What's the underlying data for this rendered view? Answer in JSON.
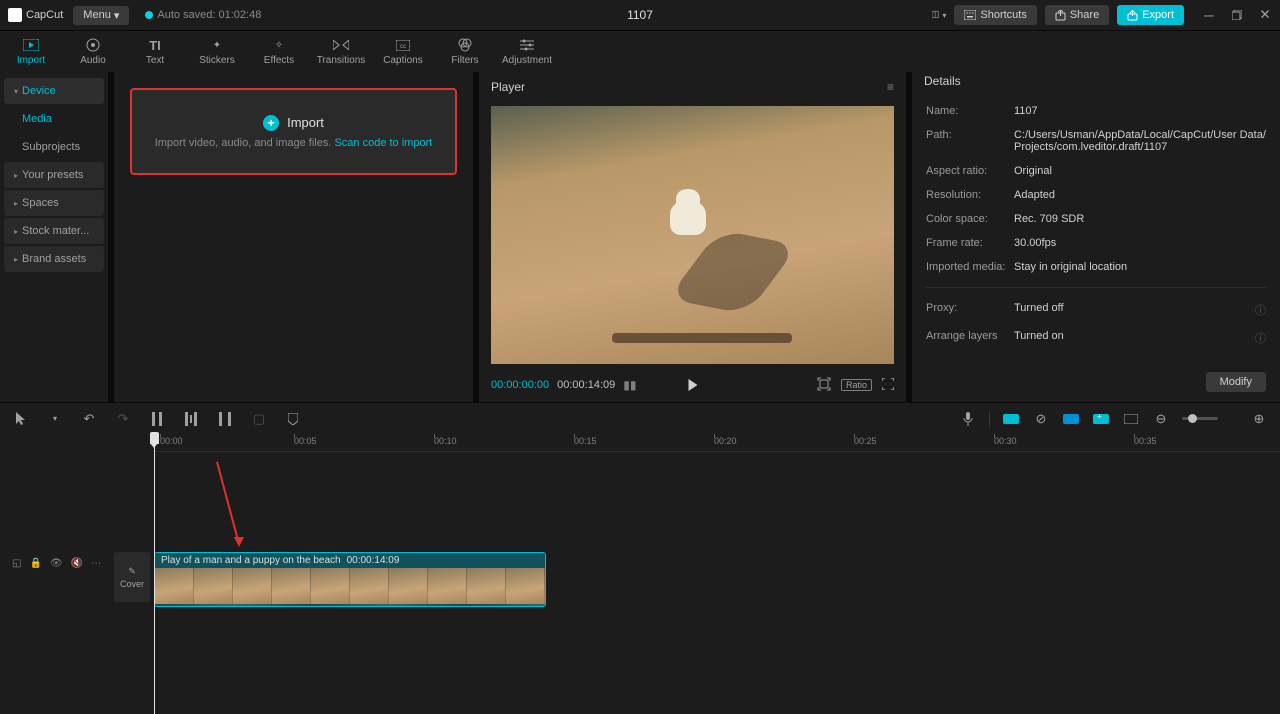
{
  "app": {
    "name": "CapCut",
    "menu_label": "Menu"
  },
  "autosave": {
    "label": "Auto saved: 01:02:48"
  },
  "project_title": "1107",
  "titlebar": {
    "shortcuts": "Shortcuts",
    "share": "Share",
    "export": "Export"
  },
  "ribbon": [
    {
      "id": "import",
      "label": "Import",
      "active": true
    },
    {
      "id": "audio",
      "label": "Audio"
    },
    {
      "id": "text",
      "label": "Text"
    },
    {
      "id": "stickers",
      "label": "Stickers"
    },
    {
      "id": "effects",
      "label": "Effects"
    },
    {
      "id": "transitions",
      "label": "Transitions"
    },
    {
      "id": "captions",
      "label": "Captions"
    },
    {
      "id": "filters",
      "label": "Filters"
    },
    {
      "id": "adjustment",
      "label": "Adjustment"
    }
  ],
  "sidebar": {
    "items": [
      {
        "label": "Device",
        "active": true,
        "expandable": true
      },
      {
        "label": "Media",
        "sub": true,
        "highlight": true
      },
      {
        "label": "Subprojects",
        "sub": true
      },
      {
        "label": "Your presets",
        "expandable": true
      },
      {
        "label": "Spaces",
        "expandable": true
      },
      {
        "label": "Stock mater...",
        "expandable": true
      },
      {
        "label": "Brand assets",
        "expandable": true
      }
    ]
  },
  "import_box": {
    "title": "Import",
    "subtitle": "Import video, audio, and image files. ",
    "link": "Scan code to import"
  },
  "player": {
    "header": "Player",
    "time_current": "00:00:00:00",
    "time_total": "00:00:14:09",
    "ratio": "Ratio"
  },
  "details": {
    "header": "Details",
    "name_label": "Name:",
    "name_value": "1107",
    "path_label": "Path:",
    "path_value": "C:/Users/Usman/AppData/Local/CapCut/User Data/Projects/com.lveditor.draft/1107",
    "aspect_label": "Aspect ratio:",
    "aspect_value": "Original",
    "res_label": "Resolution:",
    "res_value": "Adapted",
    "cs_label": "Color space:",
    "cs_value": "Rec. 709 SDR",
    "fr_label": "Frame rate:",
    "fr_value": "30.00fps",
    "im_label": "Imported media:",
    "im_value": "Stay in original location",
    "proxy_label": "Proxy:",
    "proxy_value": "Turned off",
    "layers_label": "Arrange layers",
    "layers_value": "Turned on",
    "modify": "Modify"
  },
  "timeline": {
    "ruler_ticks": [
      "00:00",
      "00:05",
      "00:10",
      "00:15",
      "00:20",
      "00:25",
      "00:30",
      "00:35"
    ],
    "cover": "Cover",
    "clip_name": "Play of a man and a puppy on the beach",
    "clip_duration": "00:00:14:09"
  }
}
